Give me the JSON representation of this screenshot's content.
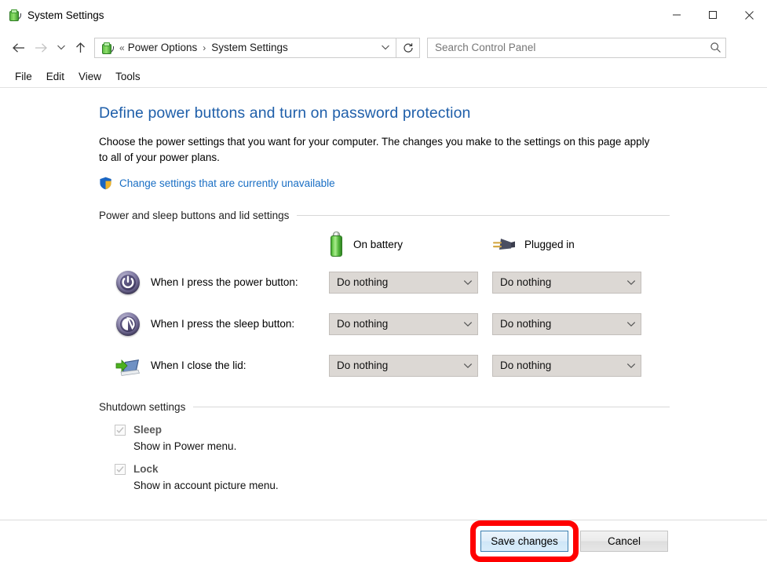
{
  "window": {
    "title": "System Settings",
    "icon": "power-options-icon",
    "controls": {
      "minimize": "minimize-icon",
      "maximize": "maximize-icon",
      "close": "close-icon"
    }
  },
  "toolbar": {
    "back_icon": "back-arrow-icon",
    "forward_icon": "forward-arrow-icon",
    "recent_icon": "recent-locations-chevron-icon",
    "up_icon": "up-arrow-icon",
    "refresh_icon": "refresh-icon",
    "breadcrumb": {
      "icon": "power-options-icon",
      "overflow": "«",
      "separator": "›",
      "segments": [
        "Power Options",
        "System Settings"
      ],
      "dropdown_icon": "chevron-down-icon"
    },
    "search": {
      "placeholder": "Search Control Panel",
      "value": "",
      "icon": "search-icon"
    }
  },
  "menubar": {
    "items": [
      "File",
      "Edit",
      "View",
      "Tools"
    ]
  },
  "main": {
    "page_title": "Define power buttons and turn on password protection",
    "description": "Choose the power settings that you want for your computer. The changes you make to the settings on this page apply to all of your power plans.",
    "uac_link": {
      "icon": "uac-shield-icon",
      "label": "Change settings that are currently unavailable"
    },
    "sections": [
      {
        "title": "Power and sleep buttons and lid settings",
        "columns": [
          {
            "icon": "battery-icon",
            "label": "On battery"
          },
          {
            "icon": "power-plug-icon",
            "label": "Plugged in"
          }
        ],
        "rows": [
          {
            "icon": "power-button-icon",
            "label": "When I press the power button:",
            "on_battery": "Do nothing",
            "plugged_in": "Do nothing"
          },
          {
            "icon": "sleep-button-icon",
            "label": "When I press the sleep button:",
            "on_battery": "Do nothing",
            "plugged_in": "Do nothing"
          },
          {
            "icon": "laptop-lid-icon",
            "label": "When I close the lid:",
            "on_battery": "Do nothing",
            "plugged_in": "Do nothing"
          }
        ]
      },
      {
        "title": "Shutdown settings",
        "checkboxes": [
          {
            "label": "Sleep",
            "description": "Show in Power menu.",
            "checked": true,
            "disabled": true
          },
          {
            "label": "Lock",
            "description": "Show in account picture menu.",
            "checked": true,
            "disabled": true
          }
        ]
      }
    ]
  },
  "footer": {
    "save_label": "Save changes",
    "cancel_label": "Cancel"
  },
  "annotation": {
    "type": "highlight-rectangle",
    "target": "save-changes-button",
    "color": "#ff0000"
  },
  "colors": {
    "title_blue": "#1f5faa",
    "link_blue": "#1a6fc4",
    "highlight_red": "#ff0000",
    "combo_bg": "#dcd8d4",
    "primary_btn_border": "#3c7fb1"
  }
}
